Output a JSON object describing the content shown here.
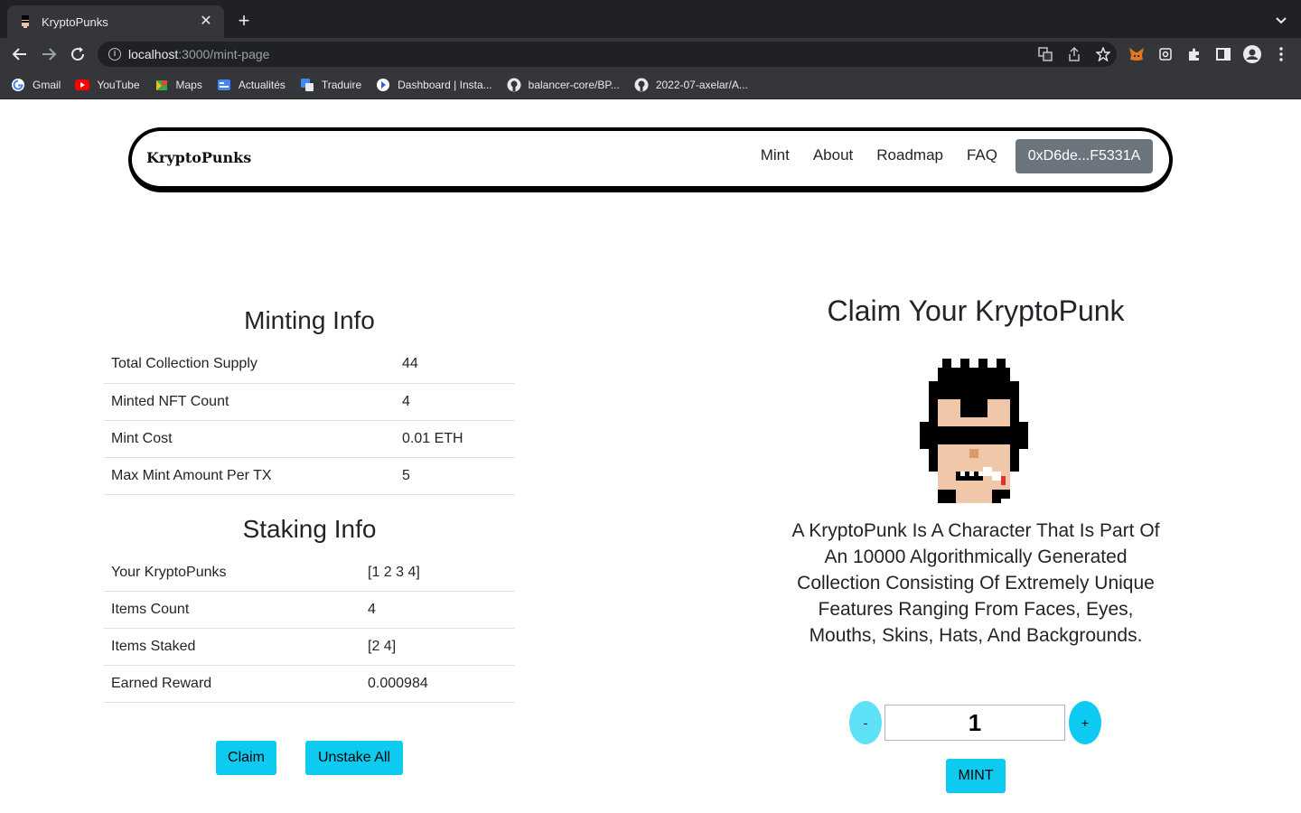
{
  "browser": {
    "tab_title": "KryptoPunks",
    "url_host": "localhost",
    "url_path": ":3000/mint-page",
    "bookmarks": [
      {
        "label": "Gmail",
        "icon": "gmail-icon"
      },
      {
        "label": "YouTube",
        "icon": "youtube-icon"
      },
      {
        "label": "Maps",
        "icon": "maps-icon"
      },
      {
        "label": "Actualités",
        "icon": "news-icon"
      },
      {
        "label": "Traduire",
        "icon": "translate-icon"
      },
      {
        "label": "Dashboard | Insta...",
        "icon": "dashboard-icon"
      },
      {
        "label": "balancer-core/BP...",
        "icon": "github-icon"
      },
      {
        "label": "2022-07-axelar/A...",
        "icon": "github-icon"
      }
    ]
  },
  "navbar": {
    "brand": "KryptoPunks",
    "links": [
      "Mint",
      "About",
      "Roadmap",
      "FAQ"
    ],
    "wallet": "0xD6de...F5331A"
  },
  "minting_info": {
    "title": "Minting Info",
    "rows": [
      {
        "label": "Total Collection Supply",
        "value": "44"
      },
      {
        "label": "Minted NFT Count",
        "value": "4"
      },
      {
        "label": "Mint Cost",
        "value": "0.01 ETH"
      },
      {
        "label": "Max Mint Amount Per TX",
        "value": "5"
      }
    ]
  },
  "staking_info": {
    "title": "Staking Info",
    "rows": [
      {
        "label": "Your KryptoPunks",
        "value": "[1 2 3 4]"
      },
      {
        "label": "Items Count",
        "value": "4"
      },
      {
        "label": "Items Staked",
        "value": "[2 4]"
      },
      {
        "label": "Earned Reward",
        "value": "0.000984"
      }
    ],
    "claim_label": "Claim",
    "unstake_label": "Unstake All"
  },
  "claim": {
    "title": "Claim Your KryptoPunk",
    "description": "A KryptoPunk Is A Character That Is Part Of An 10000 Algorithmically Generated Collection Consisting Of Extremely Unique Features Ranging From Faces, Eyes, Mouths, Skins, Hats, And Backgrounds.",
    "minus_label": "-",
    "plus_label": "+",
    "quantity": "1",
    "mint_label": "MINT"
  },
  "colors": {
    "accent": "#0dcaf0",
    "accent_disabled": "#5ee0f7",
    "wallet_button": "#6c757d"
  }
}
